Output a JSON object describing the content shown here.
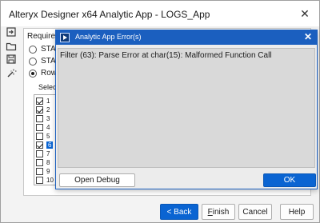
{
  "window": {
    "title": "Alteryx Designer x64 Analytic App - LOGS_App",
    "close_glyph": "✕"
  },
  "toolbar": {
    "icons": [
      "log-in-icon",
      "folder-icon",
      "save-icon",
      "wand-icon"
    ]
  },
  "panel": {
    "section_header": "Required Se",
    "radios": [
      {
        "label": "STATUS",
        "checked": false
      },
      {
        "label": "STATUS",
        "checked": false
      },
      {
        "label": "Row N",
        "checked": true
      }
    ],
    "select_label": "Select t",
    "items": [
      {
        "label": "1",
        "checked": true,
        "selected": false
      },
      {
        "label": "2",
        "checked": true,
        "selected": false
      },
      {
        "label": "3",
        "checked": false,
        "selected": false
      },
      {
        "label": "4",
        "checked": false,
        "selected": false
      },
      {
        "label": "5",
        "checked": false,
        "selected": false
      },
      {
        "label": "6",
        "checked": true,
        "selected": true
      },
      {
        "label": "7",
        "checked": false,
        "selected": false
      },
      {
        "label": "8",
        "checked": false,
        "selected": false
      },
      {
        "label": "9",
        "checked": false,
        "selected": false
      },
      {
        "label": "10",
        "checked": false,
        "selected": false
      }
    ]
  },
  "buttons": {
    "back": "< Back",
    "finish_first": "F",
    "finish_rest": "inish",
    "cancel": "Cancel",
    "help": "Help"
  },
  "dialog": {
    "title": "Analytic App Error(s)",
    "close_glyph": "✕",
    "message": "Filter (63): Parse Error at char(15): Malformed Function Call",
    "open_debug": "Open Debug",
    "ok": "OK"
  },
  "colors": {
    "accent": "#0a64d2",
    "dialog_title": "#1b5fbf"
  }
}
